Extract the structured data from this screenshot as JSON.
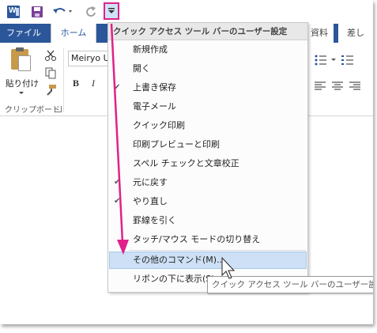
{
  "qat": {
    "app_icon_letter": "W"
  },
  "tabs": [
    {
      "label": "ファイル"
    },
    {
      "label": "ホーム"
    },
    {
      "label": "資料"
    },
    {
      "label": "差し"
    }
  ],
  "ribbon": {
    "paste_label": "貼り付け",
    "font_name": "Meiryo U",
    "bold": "B",
    "italic": "I",
    "clipboard_group": "クリップボード"
  },
  "menu": {
    "header": "クイック アクセス ツール バーのユーザー設定",
    "items": [
      {
        "label": "新規作成",
        "checked": false
      },
      {
        "label": "開く",
        "checked": false
      },
      {
        "label": "上書き保存",
        "checked": true
      },
      {
        "label": "電子メール",
        "checked": false
      },
      {
        "label": "クイック印刷",
        "checked": false
      },
      {
        "label": "印刷プレビューと印刷",
        "checked": false
      },
      {
        "label": "スペル チェックと文章校正",
        "checked": false
      },
      {
        "label": "元に戻す",
        "checked": true
      },
      {
        "label": "やり直し",
        "checked": true
      },
      {
        "label": "罫線を引く",
        "checked": false
      },
      {
        "label": "タッチ/マウス モードの切り替え",
        "checked": false
      }
    ],
    "more_commands": "その他のコマンド(M)...",
    "show_below": "リボンの下に表示(S)"
  },
  "tooltip": "クイック アクセス ツール バーのユーザー設定",
  "colors": {
    "accent": "#2b579a",
    "annotation": "#e0218a",
    "highlight": "#cde0f5"
  }
}
